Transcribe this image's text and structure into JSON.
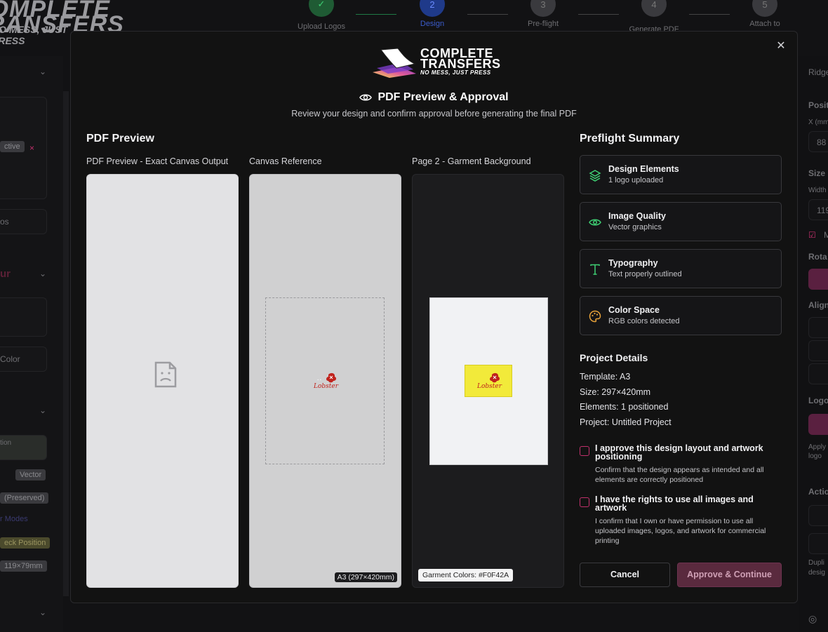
{
  "background": {
    "brand_line1": "COMPLETE",
    "brand_line2": "TRANSFERS",
    "brand_line3": "NO MESS, JUST PRESS",
    "steps": [
      {
        "label": "Upload Logos",
        "num": "✓"
      },
      {
        "label": "Design",
        "num": "2"
      },
      {
        "label": "Pre-flight",
        "num": "3"
      },
      {
        "label": "Generate PDF",
        "num": "4"
      },
      {
        "label": "Attach to",
        "num": "5"
      }
    ],
    "left_fragments": [
      "ctive",
      "×",
      "os",
      "ur",
      "Color",
      "tion",
      "Vector",
      "(Preserved)",
      "r Modes",
      "eck Position",
      "119×79mm"
    ],
    "right_fragments": [
      "Ridge",
      "Posit",
      "X (mm",
      "88",
      "Size",
      "Width",
      "119",
      "M",
      "Rota",
      "Align",
      "Logo",
      "Apply",
      "logo",
      "Actio",
      "Dupli",
      "desig"
    ]
  },
  "modal": {
    "brand": {
      "line1": "COMPLETE",
      "line2": "TRANSFERS",
      "line3": "NO MESS, JUST PRESS"
    },
    "title": "PDF Preview & Approval",
    "subtitle": "Review your design and confirm approval before generating the final PDF",
    "preview_section_title": "PDF Preview",
    "panels": [
      {
        "label": "PDF Preview - Exact Canvas Output"
      },
      {
        "label": "Canvas Reference",
        "badge": "A3 (297×420mm)"
      },
      {
        "label": "Page 2 - Garment Background",
        "badge": "Garment Colors: #F0F42A"
      }
    ],
    "preflight_title": "Preflight Summary",
    "preflight": [
      {
        "name": "Design Elements",
        "desc": "1 logo uploaded",
        "icon": "layers-icon"
      },
      {
        "name": "Image Quality",
        "desc": "Vector graphics",
        "icon": "eye-icon"
      },
      {
        "name": "Typography",
        "desc": "Text properly outlined",
        "icon": "type-icon"
      },
      {
        "name": "Color Space",
        "desc": "RGB colors detected",
        "icon": "palette-icon"
      }
    ],
    "project_title": "Project Details",
    "project": {
      "template": "Template: A3",
      "size": "Size: 297×420mm",
      "elements": "Elements: 1 positioned",
      "project": "Project: Untitled Project"
    },
    "approvals": [
      {
        "title": "I approve this design layout and artwork positioning",
        "desc": "Confirm that the design appears as intended and all elements are correctly positioned",
        "checked": false
      },
      {
        "title": "I have the rights to use all images and artwork",
        "desc": "I confirm that I own or have permission to use all uploaded images, logos, and artwork for commercial printing",
        "checked": false
      }
    ],
    "cancel_label": "Cancel",
    "approve_label": "Approve & Continue",
    "logo_text": "Lobster"
  },
  "colors": {
    "accent_pink": "#C0306B",
    "approve_disabled": "#5A2A3E",
    "success_green": "#3ECF73",
    "warning_orange": "#E8A23A",
    "garment_color": "#F0F42A"
  }
}
